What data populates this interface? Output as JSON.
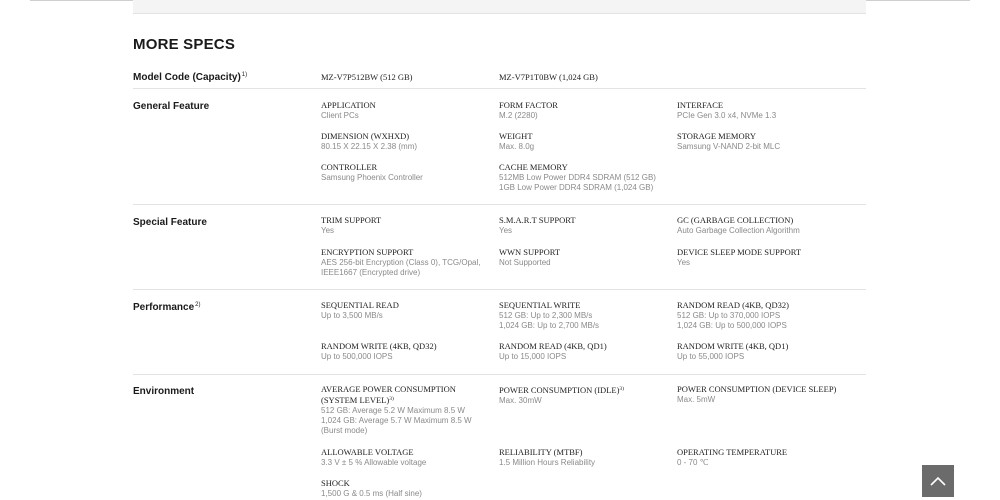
{
  "page": {
    "title": "MORE SPECS"
  },
  "model_code": {
    "label": "Model Code (Capacity)",
    "note": "1)",
    "models": [
      "MZ-V7P512BW (512 GB)",
      "MZ-V7P1T0BW (1,024 GB)"
    ]
  },
  "general": {
    "label": "General Feature",
    "specs": [
      {
        "name": "APPLICATION",
        "value": "Client PCs"
      },
      {
        "name": "FORM FACTOR",
        "value": "M.2 (2280)"
      },
      {
        "name": "INTERFACE",
        "value": "PCIe Gen 3.0 x4, NVMe 1.3"
      },
      {
        "name": "DIMENSION (WxHxD)",
        "value": "80.15 X 22.15 X 2.38 (mm)"
      },
      {
        "name": "WEIGHT",
        "value": "Max. 8.0g"
      },
      {
        "name": "STORAGE MEMORY",
        "value": "Samsung V-NAND 2-bit MLC"
      },
      {
        "name": "CONTROLLER",
        "value": "Samsung Phoenix Controller"
      },
      {
        "name": "CACHE MEMORY",
        "value": "512MB Low Power DDR4 SDRAM (512 GB)\n1GB Low Power DDR4 SDRAM (1,024 GB)"
      }
    ]
  },
  "special": {
    "label": "Special Feature",
    "specs": [
      {
        "name": "TRIM SUPPORT",
        "value": "Yes"
      },
      {
        "name": "S.M.A.R.T SUPPORT",
        "value": "Yes"
      },
      {
        "name": "GC (GARBAGE COLLECTION)",
        "value": "Auto Garbage Collection Algorithm"
      },
      {
        "name": "ENCRYPTION SUPPORT",
        "value": "AES 256-bit Encryption (Class 0), TCG/Opal,\nIEEE1667 (Encrypted drive)"
      },
      {
        "name": "WWN SUPPORT",
        "value": "Not Supported"
      },
      {
        "name": "DEVICE SLEEP MODE SUPPORT",
        "value": "Yes"
      }
    ]
  },
  "performance": {
    "label": "Performance",
    "note": "2)",
    "specs": [
      {
        "name": "SEQUENTIAL READ",
        "value": "Up to 3,500 MB/s"
      },
      {
        "name": "SEQUENTIAL WRITE",
        "value": "512 GB: Up to 2,300 MB/s\n1,024 GB: Up to 2,700 MB/s"
      },
      {
        "name": "RANDOM READ (4KB, QD32)",
        "value": "512 GB: Up to 370,000 IOPS\n1,024 GB: Up to 500,000 IOPS"
      },
      {
        "name": "RANDOM WRITE (4KB, QD32)",
        "value": "Up to 500,000 IOPS"
      },
      {
        "name": "RANDOM READ (4KB, QD1)",
        "value": "Up to 15,000 IOPS"
      },
      {
        "name": "RANDOM WRITE (4KB, QD1)",
        "value": "Up to 55,000 IOPS"
      }
    ]
  },
  "environment": {
    "label": "Environment",
    "specs": [
      {
        "name": "AVERAGE POWER CONSUMPTION (SYSTEM LEVEL)",
        "note": "3)",
        "value": "512 GB: Average 5.2 W Maximum 8.5 W\n1,024 GB: Average 5.7 W Maximum 8.5 W\n(Burst mode)"
      },
      {
        "name": "POWER CONSUMPTION (IDLE)",
        "note": "3)",
        "value": "Max. 30mW"
      },
      {
        "name": "POWER CONSUMPTION (DEVICE SLEEP)",
        "value": "Max. 5mW"
      },
      {
        "name": "ALLOWABLE VOLTAGE",
        "value": "3.3 V ± 5 % Allowable voltage"
      },
      {
        "name": "RELIABILITY (MTBF)",
        "value": "1.5 Million Hours Reliability"
      },
      {
        "name": "OPERATING TEMPERATURE",
        "value": "0 - 70 ℃"
      },
      {
        "name": "SHOCK",
        "value": "1,500 G & 0.5 ms (Half sine)"
      }
    ]
  },
  "icons": {
    "back_to_top": "chevron-up-icon"
  },
  "colors": {
    "back_to_top_bg": "#6b6b6b",
    "value_text": "#8a8a8a"
  }
}
